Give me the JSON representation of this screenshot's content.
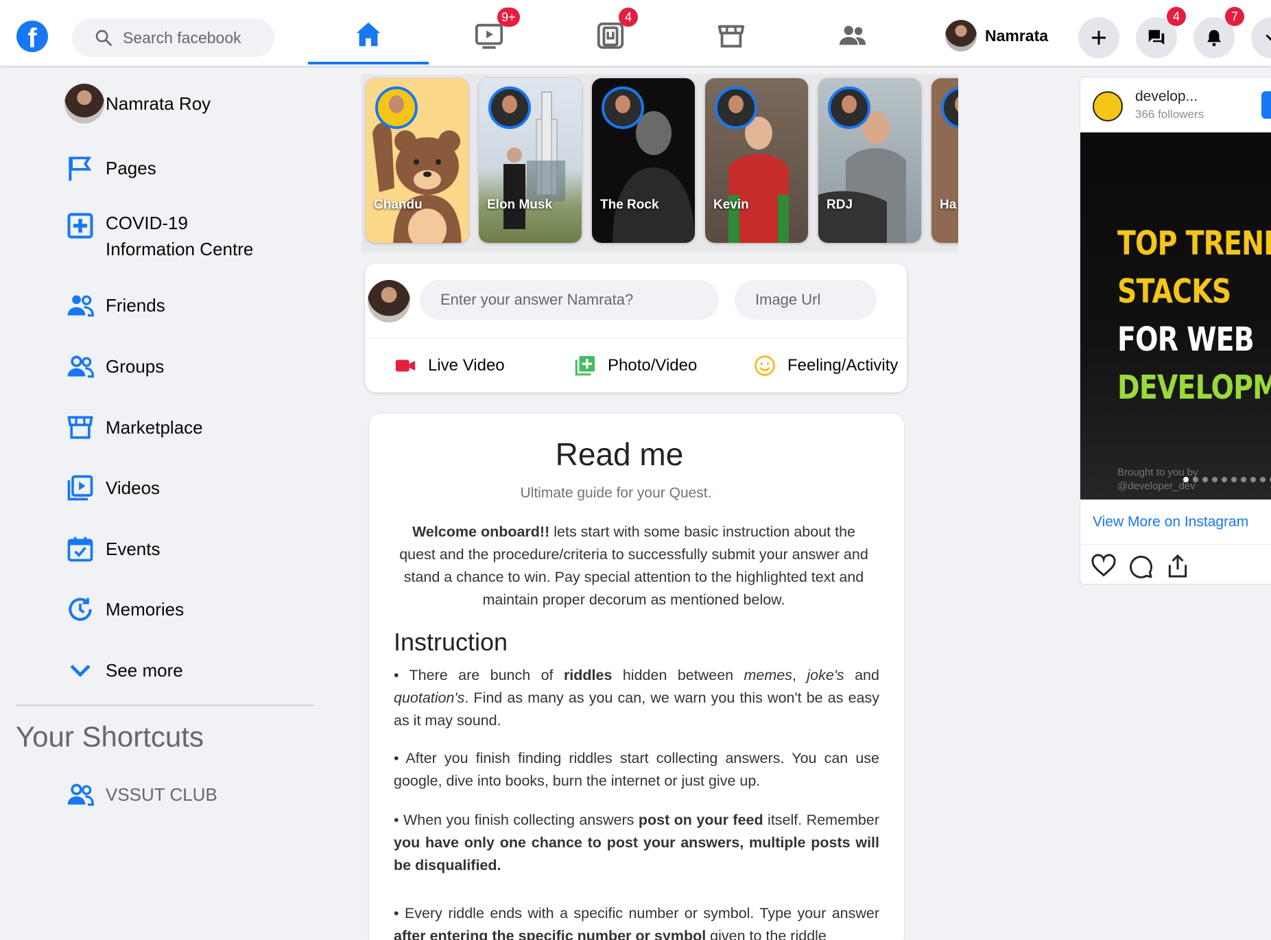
{
  "header": {
    "search_placeholder": "Search facebook",
    "nav": [
      {
        "name": "home",
        "badge": ""
      },
      {
        "name": "watch",
        "badge": "9+"
      },
      {
        "name": "gaming",
        "badge": "4"
      },
      {
        "name": "marketplace",
        "badge": ""
      },
      {
        "name": "groups",
        "badge": ""
      }
    ],
    "profile_name": "Namrata",
    "messenger_badge": "4",
    "notifications_badge": "7"
  },
  "sidebar": {
    "user_name": "Namrata Roy",
    "items": [
      {
        "label": "Pages",
        "icon": "flag-icon"
      },
      {
        "label": "COVID-19",
        "label2": "Information Centre",
        "icon": "medical-plus-icon"
      },
      {
        "label": "Friends",
        "icon": "friends-icon"
      },
      {
        "label": "Groups",
        "icon": "groups-icon"
      },
      {
        "label": "Marketplace",
        "icon": "storefront-icon"
      },
      {
        "label": "Videos",
        "icon": "video-library-icon"
      },
      {
        "label": "Events",
        "icon": "calendar-check-icon"
      },
      {
        "label": "Memories",
        "icon": "memories-clock-icon"
      },
      {
        "label": "See more",
        "icon": "chevron-down-icon"
      }
    ],
    "shortcuts_title": "Your Shortcuts",
    "shortcuts": [
      {
        "label": "VSSUT CLUB",
        "icon": "group-icon"
      }
    ]
  },
  "stories": [
    {
      "name": "Chandu"
    },
    {
      "name": "Elon Musk"
    },
    {
      "name": "The Rock"
    },
    {
      "name": "Kevin"
    },
    {
      "name": "RDJ"
    },
    {
      "name": "Ha"
    }
  ],
  "composer": {
    "answer_placeholder": "Enter your answer Namrata?",
    "image_placeholder": "Image Url",
    "actions": [
      {
        "label": "Live Video",
        "icon": "video-camera-icon",
        "color": "#e41e3f"
      },
      {
        "label": "Photo/Video",
        "icon": "photo-library-icon",
        "color": "#45bd62"
      },
      {
        "label": "Feeling/Activity",
        "icon": "smiley-icon",
        "color": "#f7b928"
      }
    ]
  },
  "readme": {
    "title": "Read me",
    "subtitle": "Ultimate guide for your Quest.",
    "intro_bold": "Welcome onboard!!",
    "intro_rest": " lets start with some basic instruction about the quest and the procedure/criteria to successfully submit your answer and stand a chance to win. Pay special attention to the highlighted text and maintain proper decorum as mentioned below.",
    "instruction_heading": "Instruction",
    "p1": {
      "a": "• There are bunch of ",
      "b": "riddles",
      "c": " hidden between ",
      "d": "memes",
      "e": ", ",
      "f": "joke's",
      "g": " and ",
      "h": "quotation's",
      "i": ". Find as many as you can, we warn you this won't be as easy as it may sound."
    },
    "p2": "• After you finish finding riddles start collecting answers. You can use google, dive into books, burn the internet or just give up.",
    "p3": {
      "a": "• When you finish collecting answers ",
      "b": "post on your feed",
      "c": " itself. Remember ",
      "d": "you have only one chance to post your answers, multiple posts will be disqualified."
    },
    "p4": {
      "a": "• Every riddle ends with a specific number or symbol. Type your answer ",
      "b": "after entering the specific number or symbol",
      "c": " given to the riddle"
    }
  },
  "instagram": {
    "username": "develop...",
    "followers": "366 followers",
    "image_text": [
      "TOP TRENDIN",
      "STACKS",
      "FOR WEB",
      "DEVELOPME"
    ],
    "credit": "Brought to you by\n@developer_dev",
    "view_more": "View More on Instagram",
    "accent": "#1877f2"
  },
  "colors": {
    "brand": "#1877f2",
    "badge": "#e41e3f",
    "page_bg": "#f0f2f5",
    "insta_yellow": "#f5c518",
    "insta_green": "#9ad93b"
  }
}
